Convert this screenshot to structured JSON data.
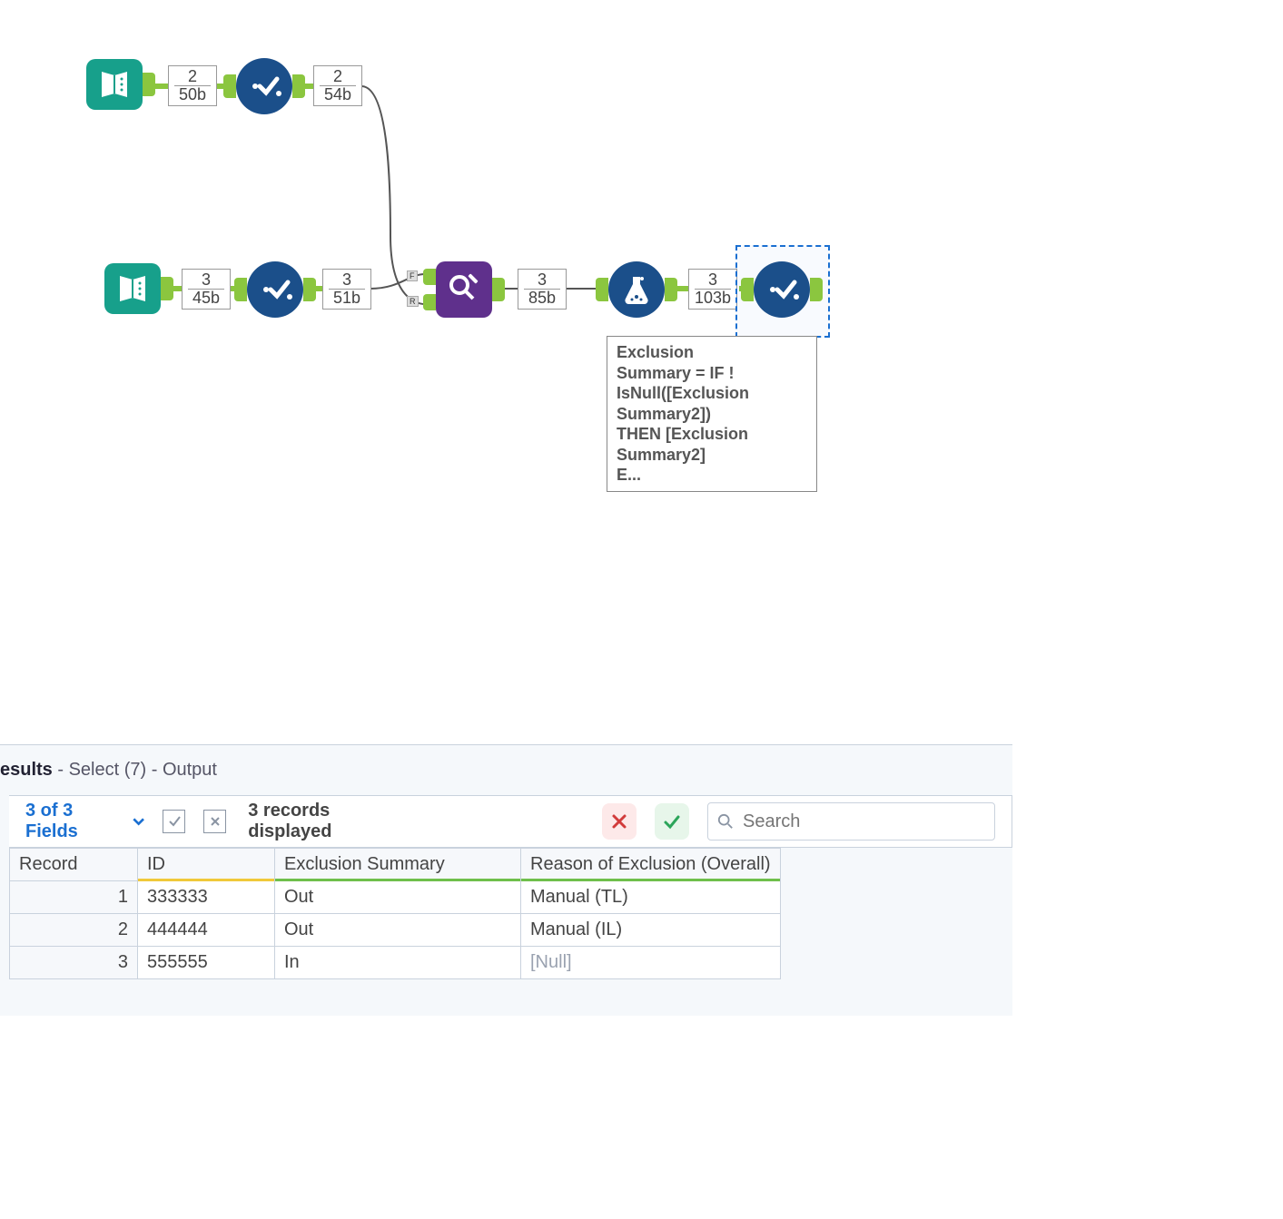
{
  "canvas": {
    "badges": {
      "b1": {
        "count": "2",
        "size": "50b"
      },
      "b2": {
        "count": "2",
        "size": "54b"
      },
      "b3": {
        "count": "3",
        "size": "45b"
      },
      "b4": {
        "count": "3",
        "size": "51b"
      },
      "b5": {
        "count": "3",
        "size": "85b"
      },
      "b6": {
        "count": "3",
        "size": "103b"
      }
    },
    "find_replace_anchors": {
      "top": "F",
      "bottom": "R"
    },
    "formula_note": "Exclusion\nSummary = IF !\nIsNull([Exclusion\nSummary2])\nTHEN [Exclusion\nSummary2]\nE..."
  },
  "results": {
    "title_strong": "esults",
    "title_rest": " - Select (7) - Output",
    "fields_label": "3 of 3 Fields",
    "records_label": "3 records displayed",
    "search_placeholder": "Search",
    "columns": [
      "Record",
      "ID",
      "Exclusion Summary",
      "Reason of Exclusion (Overall)"
    ],
    "rows": [
      {
        "record": "1",
        "id": "333333",
        "excl": "Out",
        "reason": "Manual (TL)",
        "null": false
      },
      {
        "record": "2",
        "id": "444444",
        "excl": "Out",
        "reason": "Manual (IL)",
        "null": false
      },
      {
        "record": "3",
        "id": "555555",
        "excl": "In",
        "reason": "[Null]",
        "null": true
      }
    ]
  }
}
